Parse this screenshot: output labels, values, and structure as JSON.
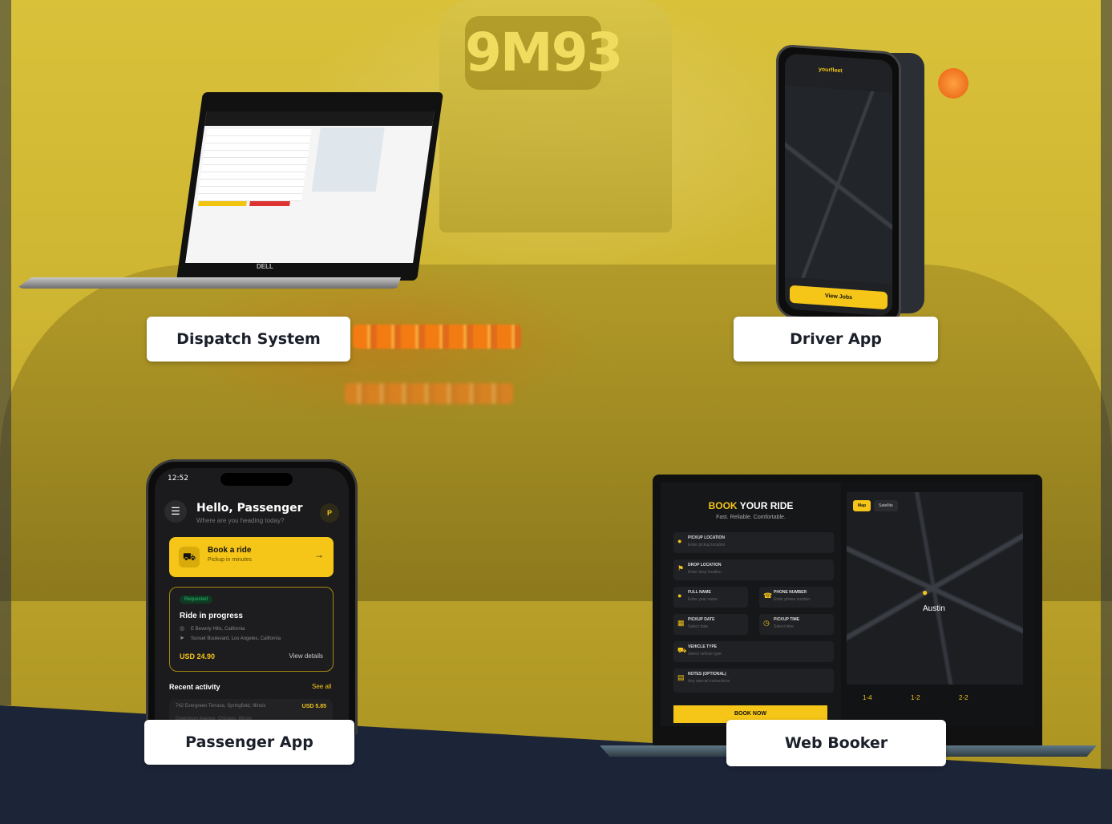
{
  "background": {
    "sign_text": "9M93",
    "accent_color": "#f5c518",
    "dark_color": "#1c2438"
  },
  "labels": {
    "dispatch": "Dispatch System",
    "driver": "Driver App",
    "passenger": "Passenger App",
    "web": "Web Booker"
  },
  "dispatch_laptop": {
    "brand": "DELL"
  },
  "driver_phone": {
    "logo": "yourfleet",
    "button": "View Jobs"
  },
  "passenger_phone": {
    "status_time": "12:52",
    "greeting": "Hello, Passenger",
    "subtitle": "Where are you heading today?",
    "avatar": "P",
    "book_title": "Book a ride",
    "book_sub": "Pickup in minutes",
    "status_badge": "Requested",
    "ride_title": "Ride in progress",
    "addr_from": "E Beverly Hills, California",
    "addr_to": "Sunset Boulevard, Los Angeles, California",
    "price": "USD 24.90",
    "view_details": "View details",
    "recent_title": "Recent activity",
    "see_all": "See all",
    "recent_row_text": "742 Evergreen Terrace, Springfield, Illinois",
    "recent_row_price": "USD 5.85",
    "recent_row_sub": "Downtown Avenue, Chicago, Illinois"
  },
  "web_booker": {
    "title_accent": "BOOK",
    "title_rest": " YOUR RIDE",
    "tagline": "Fast. Reliable. Comfortable.",
    "fields": [
      {
        "label": "PICKUP LOCATION",
        "placeholder": "Enter pickup location"
      },
      {
        "label": "DROP LOCATION",
        "placeholder": "Enter drop location"
      },
      {
        "label": "FULL NAME",
        "placeholder": "Enter your name"
      },
      {
        "label": "PHONE NUMBER",
        "placeholder": "Enter phone number"
      },
      {
        "label": "PICKUP DATE",
        "placeholder": "Select date"
      },
      {
        "label": "PICKUP TIME",
        "placeholder": "Select time"
      },
      {
        "label": "VEHICLE TYPE",
        "placeholder": "Select vehicle type"
      },
      {
        "label": "NOTES (OPTIONAL)",
        "placeholder": "Any special instructions"
      }
    ],
    "book_button": "BOOK NOW",
    "map_tab": "Map",
    "satellite_tab": "Satellite",
    "city": "Austin",
    "options": [
      "1-4",
      "1-2",
      "2-2"
    ]
  }
}
